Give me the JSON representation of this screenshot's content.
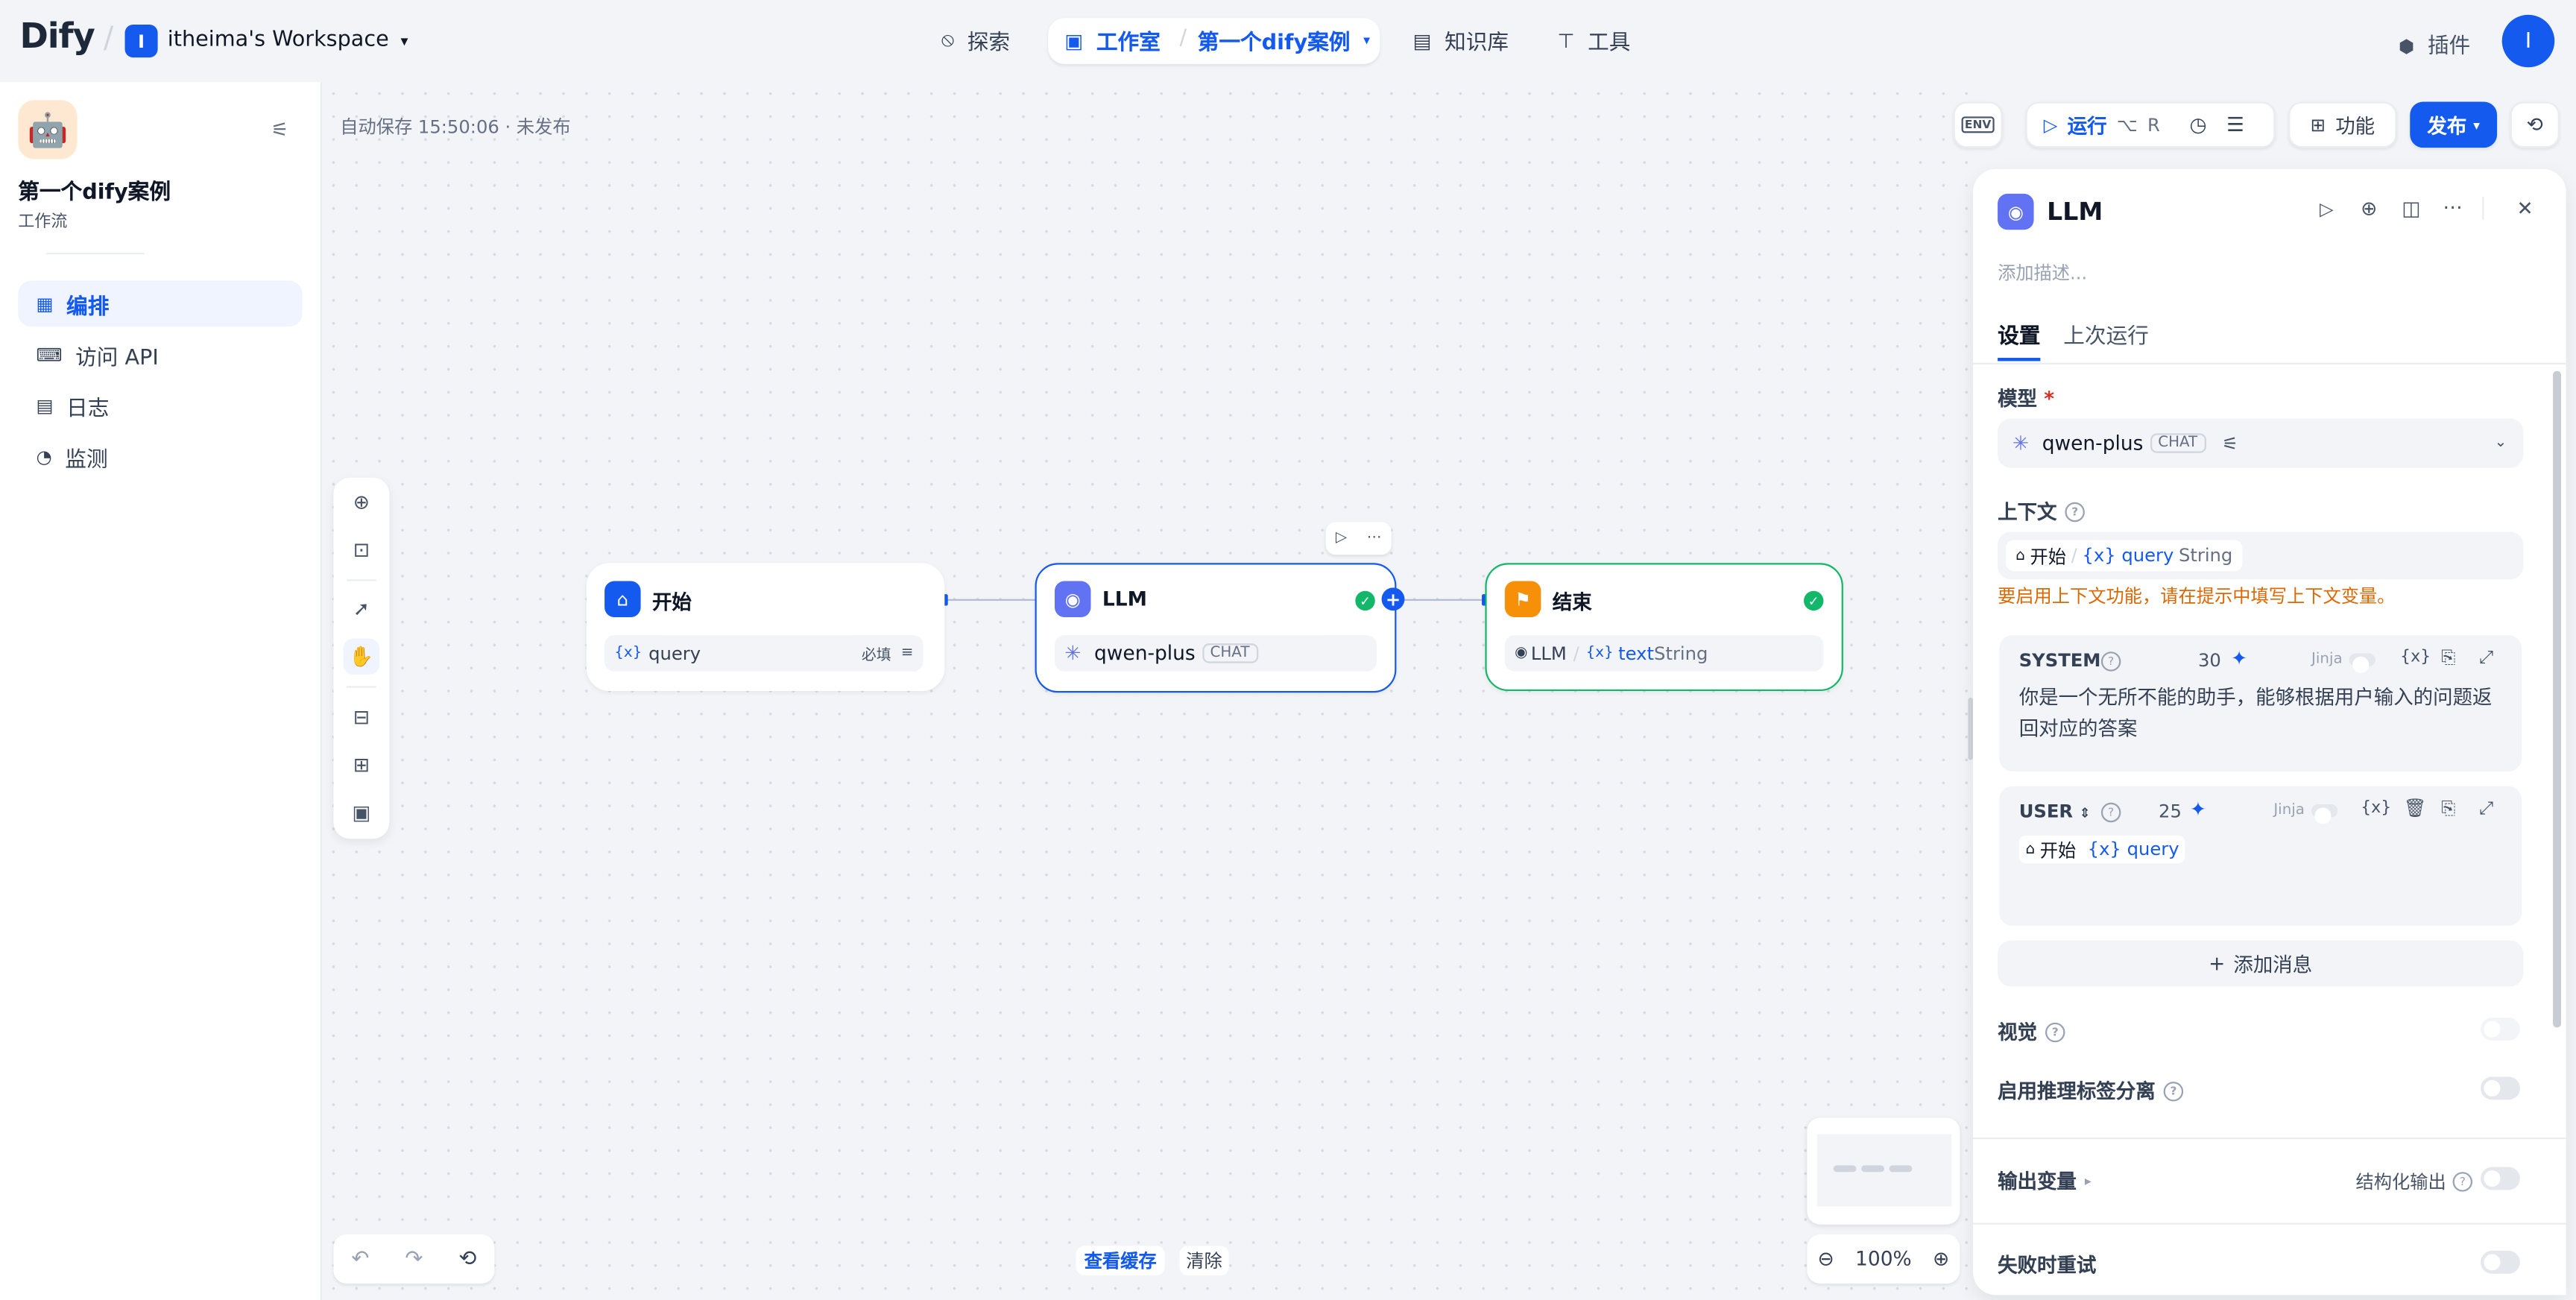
{
  "topbar": {
    "logo": "Dify",
    "workspace_badge": "I",
    "workspace_name": "itheima's Workspace",
    "nav_explore": "探索",
    "nav_studio": "工作室",
    "nav_app": "第一个dify案例",
    "nav_knowledge": "知识库",
    "nav_tools": "工具",
    "plugins": "插件",
    "avatar": "I"
  },
  "sidebar": {
    "app_icon": "🤖",
    "app_title": "第一个dify案例",
    "app_type": "工作流",
    "items": [
      {
        "label": "编排"
      },
      {
        "label": "访问 API"
      },
      {
        "label": "日志"
      },
      {
        "label": "监测"
      }
    ]
  },
  "canvas": {
    "autosave": "自动保存 15:50:06 · 未发布",
    "toolbar_top": {
      "env": "ENV",
      "run": "运行",
      "run_shortcut_alt": "⌥",
      "run_shortcut_key": "R",
      "features": "功能",
      "publish": "发布"
    },
    "nodes": {
      "start": {
        "title": "开始",
        "var_prefix": "{x}",
        "var": "query",
        "required": "必填"
      },
      "llm": {
        "title": "LLM",
        "model": "qwen-plus",
        "tag": "CHAT"
      },
      "end": {
        "title": "结束",
        "source": "LLM",
        "var_prefix": "{x}",
        "var": "text",
        "type": "String"
      }
    },
    "bottom": {
      "view_cache": "查看缓存",
      "clear": "清除",
      "zoom": "100%"
    }
  },
  "panel": {
    "title": "LLM",
    "description_placeholder": "添加描述...",
    "tabs": [
      {
        "label": "设置"
      },
      {
        "label": "上次运行"
      }
    ],
    "model_label": "模型",
    "required_mark": "*",
    "model_name": "qwen-plus",
    "model_tag": "CHAT",
    "context_label": "上下文",
    "context_node": "开始",
    "context_var": "{x} query",
    "context_type": "String",
    "context_warning": "要启用上下文功能，请在提示中填写上下文变量。",
    "system": {
      "role": "SYSTEM",
      "count": "30",
      "jinja": "Jinja",
      "var_btn": "{x}",
      "text": "你是一个无所不能的助手，能够根据用户输入的问题返回对应的答案"
    },
    "user": {
      "role": "USER",
      "count": "25",
      "jinja": "Jinja",
      "var_btn": "{x}",
      "node": "开始",
      "var": "{x} query"
    },
    "add_message": "添加消息",
    "vision": "视觉",
    "reasoning": "启用推理标签分离",
    "output_vars": "输出变量",
    "structured_output": "结构化输出",
    "retry": "失败时重试"
  },
  "colors": {
    "accent": "#155aef",
    "llm_node": "#6172f3",
    "end_node": "#f79009",
    "success": "#12b76a",
    "warning": "#dc6803"
  }
}
